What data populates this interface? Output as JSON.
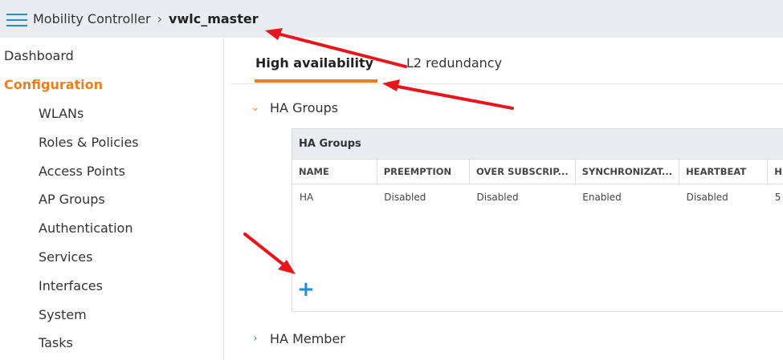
{
  "header": {
    "app": "Mobility Controller",
    "separator": "›",
    "current": "vwlc_master"
  },
  "sidebar": {
    "items": [
      {
        "label": "Dashboard"
      },
      {
        "label": "Configuration"
      },
      {
        "label": "WLANs"
      },
      {
        "label": "Roles & Policies"
      },
      {
        "label": "Access Points"
      },
      {
        "label": "AP Groups"
      },
      {
        "label": "Authentication"
      },
      {
        "label": "Services"
      },
      {
        "label": "Interfaces"
      },
      {
        "label": "System"
      },
      {
        "label": "Tasks"
      }
    ]
  },
  "tabs": [
    {
      "label": "High availability",
      "active": true
    },
    {
      "label": "L2 redundancy",
      "active": false
    }
  ],
  "sections": {
    "ha_groups": {
      "label": "HA Groups",
      "expanded": true
    },
    "ha_member": {
      "label": "HA Member",
      "expanded": false
    }
  },
  "ha_table": {
    "title": "HA Groups",
    "columns": [
      "NAME",
      "PREEMPTION",
      "OVER SUBSCRIP...",
      "SYNCHRONIZAT...",
      "HEARTBEAT",
      "H"
    ],
    "rows": [
      [
        "HA",
        "Disabled",
        "Disabled",
        "Enabled",
        "Disabled",
        "5"
      ]
    ],
    "add_symbol": "+"
  },
  "colors": {
    "accent_orange": "#f07d1a",
    "accent_blue": "#1e8fd6",
    "annotation_red": "#e8151b"
  }
}
